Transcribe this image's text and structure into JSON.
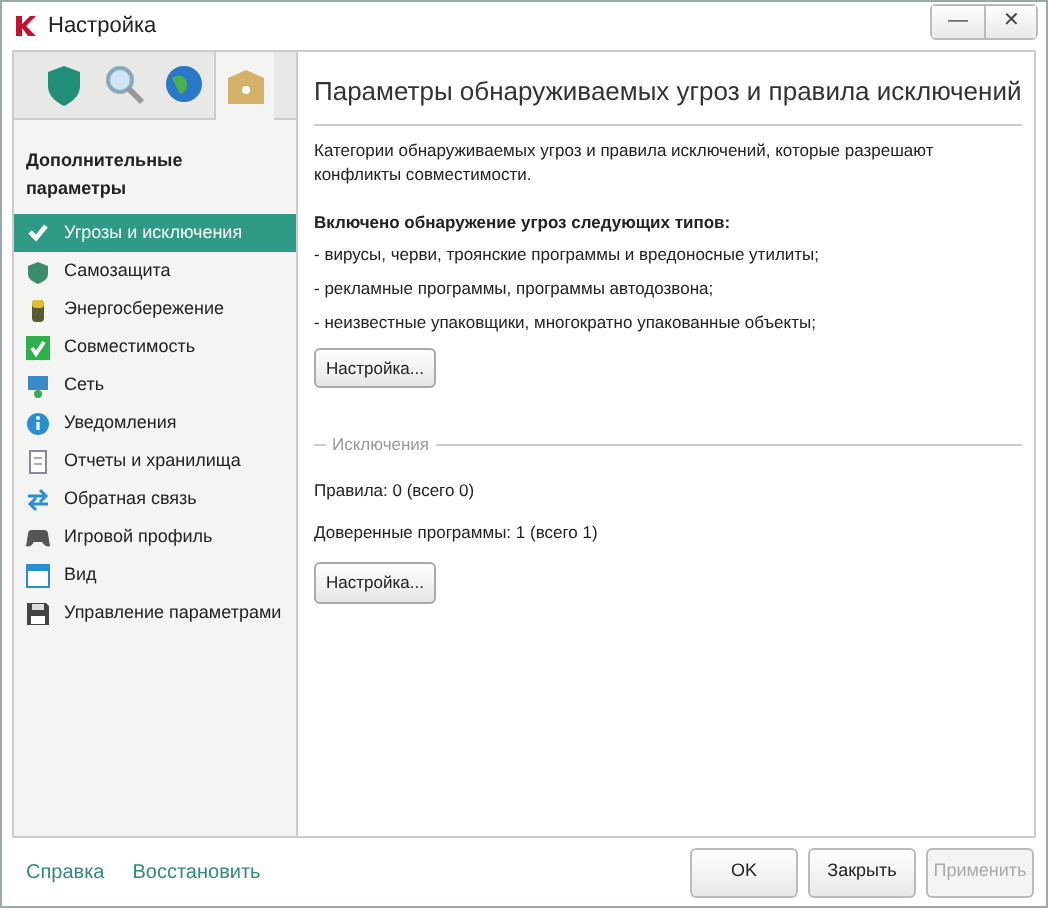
{
  "window": {
    "title": "Настройка",
    "controls": [
      "—",
      "✕"
    ]
  },
  "tabs": [
    {
      "kind": "shield",
      "selected": false
    },
    {
      "kind": "magnifier",
      "selected": false
    },
    {
      "kind": "globe",
      "selected": false
    },
    {
      "kind": "box",
      "selected": true
    }
  ],
  "sidebar": {
    "heading": "Дополнительные параметры",
    "items": [
      {
        "label": "Угрозы и исключения",
        "kind": "check",
        "selected": true
      },
      {
        "label": "Самозащита",
        "kind": "guard",
        "selected": false
      },
      {
        "label": "Энергосбережение",
        "kind": "battery",
        "selected": false
      },
      {
        "label": "Совместимость",
        "kind": "tick",
        "selected": false
      },
      {
        "label": "Сеть",
        "kind": "network",
        "selected": false
      },
      {
        "label": "Уведомления",
        "kind": "info",
        "selected": false
      },
      {
        "label": "Отчеты и хранилища",
        "kind": "report",
        "selected": false
      },
      {
        "label": "Обратная связь",
        "kind": "arrows",
        "selected": false
      },
      {
        "label": "Игровой профиль",
        "kind": "gamepad",
        "selected": false
      },
      {
        "label": "Вид",
        "kind": "view",
        "selected": false
      },
      {
        "label": "Управление параметрами",
        "kind": "disk",
        "selected": false
      }
    ]
  },
  "content": {
    "title": "Параметры обнаруживаемых угроз и правила исключений",
    "description": "Категории обнаруживаемых угроз и правила исключений, которые разрешают конфликты совместимости.",
    "detection_heading": "Включено обнаружение угроз следующих типов:",
    "detection_items": [
      "- вирусы, черви, троянские программы и вредоносные утилиты;",
      "- рекламные программы, программы автодозвона;",
      "- неизвестные упаковщики, многократно упакованные объекты;"
    ],
    "detection_button": "Настройка...",
    "exclusions_heading": "Исключения",
    "exclusions_lines": [
      "Правила: 0 (всего 0)",
      "Доверенные программы: 1 (всего 1)"
    ],
    "exclusions_button": "Настройка..."
  },
  "footer": {
    "links": [
      "Справка",
      "Восстановить"
    ],
    "buttons": [
      {
        "label": "OK",
        "disabled": false
      },
      {
        "label": "Закрыть",
        "disabled": false
      },
      {
        "label": "Применить",
        "disabled": true
      }
    ]
  }
}
